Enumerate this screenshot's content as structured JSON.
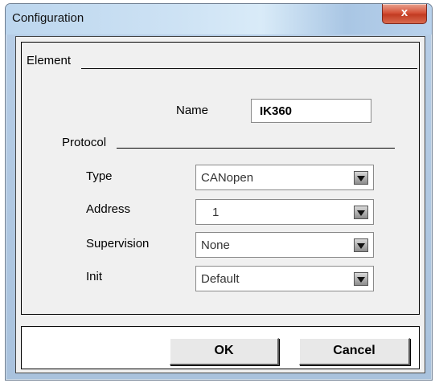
{
  "window": {
    "title": "Configuration",
    "close_label": "x"
  },
  "element_group": {
    "title": "Element"
  },
  "name_field": {
    "label": "Name",
    "value": "IK360"
  },
  "protocol": {
    "title": "Protocol",
    "rows": [
      {
        "label": "Type",
        "value": "CANopen"
      },
      {
        "label": "Address",
        "value": "1"
      },
      {
        "label": "Supervision",
        "value": "None"
      },
      {
        "label": "Init",
        "value": "Default"
      }
    ]
  },
  "buttons": {
    "ok": "OK",
    "cancel": "Cancel"
  },
  "icons": {
    "dropdown": "chevron-down-icon"
  }
}
